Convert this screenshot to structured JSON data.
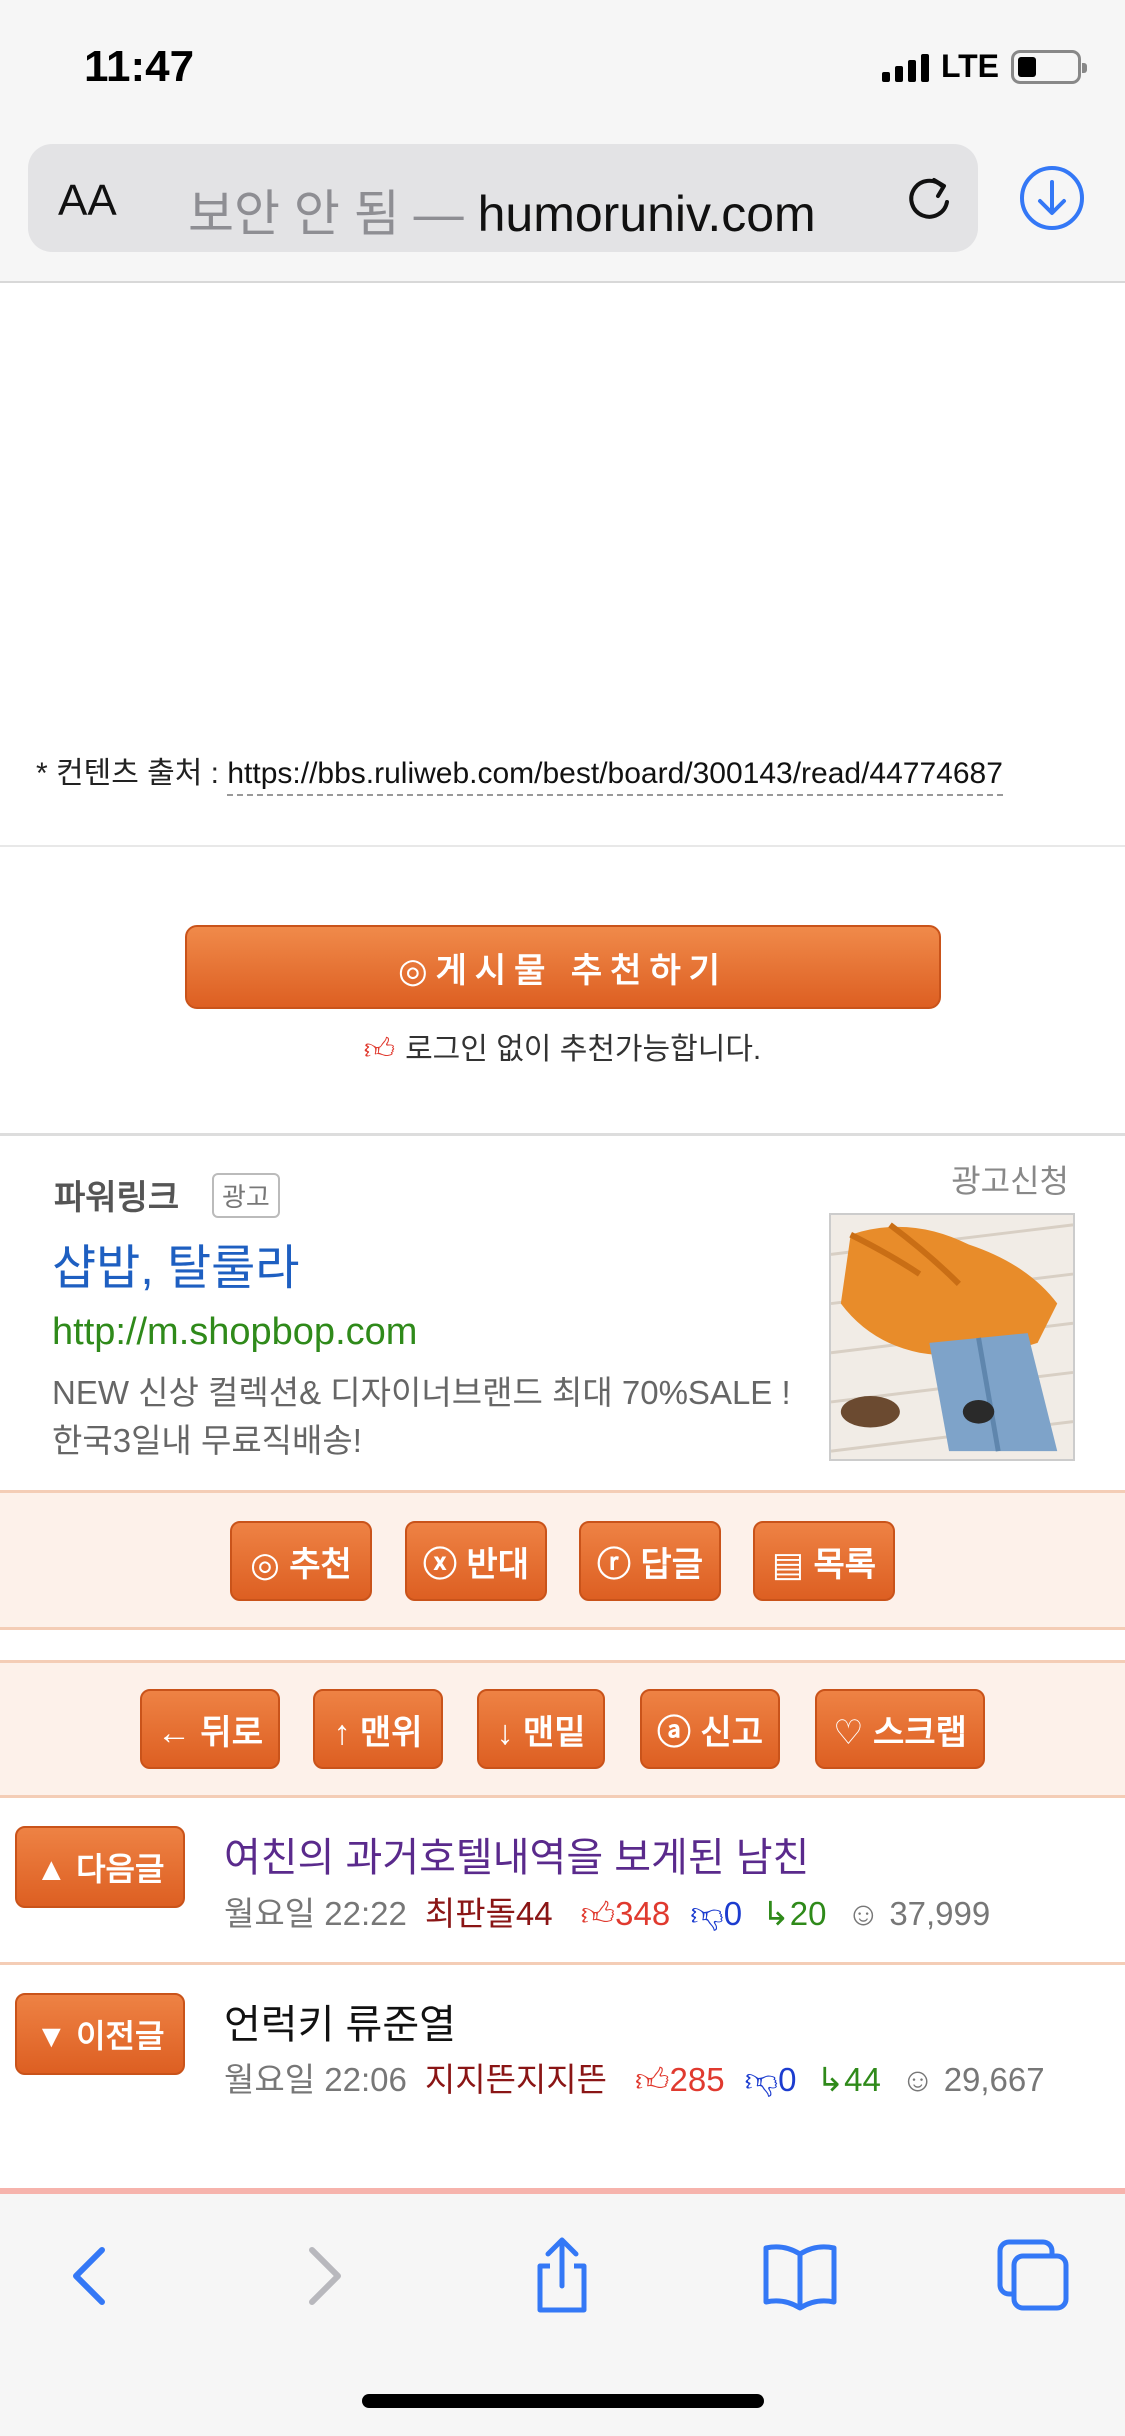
{
  "status": {
    "time": "11:47",
    "network": "LTE"
  },
  "browser": {
    "aa_label": "AA",
    "insecure_label": "보안 안 됨 —",
    "domain": "humoruniv.com"
  },
  "content": {
    "source_prefix": "* 컨텐츠 출처 : ",
    "source_url": "https://bbs.ruliweb.com/best/board/300143/read/44774687",
    "recommend_button": "◎게시물  추천하기",
    "recommend_note": "로그인 없이 추천가능합니다."
  },
  "ad": {
    "powerlink": "파워링크",
    "badge": "광고",
    "apply": "광고신청",
    "title": "샵밥, 탈룰라",
    "url": "http://m.shopbop.com",
    "description": "NEW 신상 컬렉션& 디자이너브랜드 최대 70%SALE ! 한국3일내 무료직배송!"
  },
  "actions_row1": [
    {
      "label": "◎ 추천"
    },
    {
      "label": "ⓧ 반대"
    },
    {
      "label": "ⓡ 답글"
    },
    {
      "label": "▤ 목록"
    }
  ],
  "actions_row2": [
    {
      "label": "← 뒤로"
    },
    {
      "label": "↑ 맨위"
    },
    {
      "label": "↓ 맨밑"
    },
    {
      "label": "ⓐ 신고"
    },
    {
      "label": "♡ 스크랩"
    }
  ],
  "posts": [
    {
      "nav": "▲ 다음글",
      "title": "여친의 과거호텔내역을 보게된 남친",
      "title_color": "#5a2a8c",
      "time": "월요일 22:22",
      "author": "최판돌44",
      "up": "348",
      "down": "0",
      "replies": "20",
      "views": "37,999"
    },
    {
      "nav": "▼ 이전글",
      "title": "언럭키 류준열",
      "title_color": "#111111",
      "time": "월요일 22:06",
      "author": "지지뜬지지뜬",
      "up": "285",
      "down": "0",
      "replies": "44",
      "views": "29,667"
    }
  ],
  "colors": {
    "accent": "#dd5f22",
    "link": "#1e5fc1",
    "safari_blue": "#3478f6"
  }
}
